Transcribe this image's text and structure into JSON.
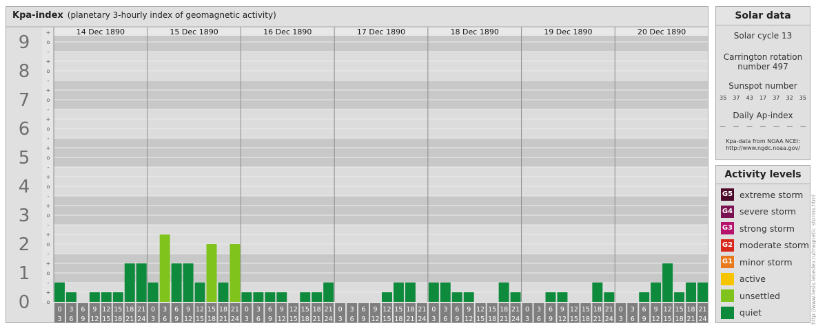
{
  "header": {
    "title": "Kpa-index",
    "subtitle": "(planetary 3-hourly index of geomagnetic activity)"
  },
  "chart_data": {
    "type": "bar",
    "title": "Kpa-index",
    "subtitle": "(planetary 3-hourly index of geomagnetic activity)",
    "days": [
      "14 Dec 1890",
      "15 Dec 1890",
      "16 Dec 1890",
      "17 Dec 1890",
      "18 Dec 1890",
      "19 Dec 1890",
      "20 Dec 1890"
    ],
    "interval_start": [
      "0",
      "3",
      "6",
      "9",
      "12",
      "15",
      "18",
      "21"
    ],
    "interval_end": [
      "3",
      "6",
      "9",
      "12",
      "15",
      "18",
      "21",
      "24"
    ],
    "y_ticks": [
      "0",
      "1",
      "2",
      "3",
      "4",
      "5",
      "6",
      "7",
      "8",
      "9"
    ],
    "sub_ticks": [
      "o",
      "+",
      "-"
    ],
    "ylim": [
      0,
      9.33
    ],
    "thresholds": {
      "quiet_max": 1.67,
      "unsettled_max": 3.67
    },
    "values": [
      [
        0.67,
        0.33,
        0,
        0.33,
        0.33,
        0.33,
        1.33,
        1.33
      ],
      [
        0.67,
        2.33,
        1.33,
        1.33,
        0.67,
        2,
        0.67,
        2
      ],
      [
        0.33,
        0.33,
        0.33,
        0.33,
        0,
        0.33,
        0.33,
        0.67
      ],
      [
        0,
        0,
        0,
        0,
        0.33,
        0.67,
        0.67,
        0
      ],
      [
        0.67,
        0.67,
        0.33,
        0.33,
        0,
        0,
        0.67,
        0.33
      ],
      [
        0,
        0,
        0.33,
        0.33,
        0,
        0,
        0.67,
        0.33
      ],
      [
        0,
        0,
        0.33,
        0.67,
        1.33,
        0.33,
        0.67,
        0.67
      ]
    ]
  },
  "solar": {
    "title": "Solar data",
    "cycle": "Solar cycle 13",
    "carrington_1": "Carrington rotation",
    "carrington_2": "number 497",
    "sunspot_label": "Sunspot number",
    "sunspots": [
      "35",
      "37",
      "43",
      "17",
      "37",
      "32",
      "35"
    ],
    "ap_label": "Daily Ap-index",
    "ap_values": [
      "—",
      "—",
      "—",
      "—",
      "—",
      "—",
      "—"
    ],
    "source_1": "Kpa-data from NOAA NCEI:",
    "source_2": "http://www.ngdc.noaa.gov/"
  },
  "activity": {
    "title": "Activity levels",
    "levels": [
      {
        "code": "G5",
        "label": "extreme storm",
        "color": "#4b0a2a"
      },
      {
        "code": "G4",
        "label": "severe storm",
        "color": "#7a1151"
      },
      {
        "code": "G3",
        "label": "strong storm",
        "color": "#b5126e"
      },
      {
        "code": "G2",
        "label": "moderate storm",
        "color": "#d8281c"
      },
      {
        "code": "G1",
        "label": "minor storm",
        "color": "#e8791c"
      },
      {
        "code": "",
        "label": "active",
        "color": "#f7c400"
      },
      {
        "code": "",
        "label": "unsettled",
        "color": "#7fc31c"
      },
      {
        "code": "",
        "label": "quiet",
        "color": "#0e8a3c"
      }
    ]
  },
  "watermark": "http://www.tesis.lebedev.ru/magnetic_storms.html"
}
